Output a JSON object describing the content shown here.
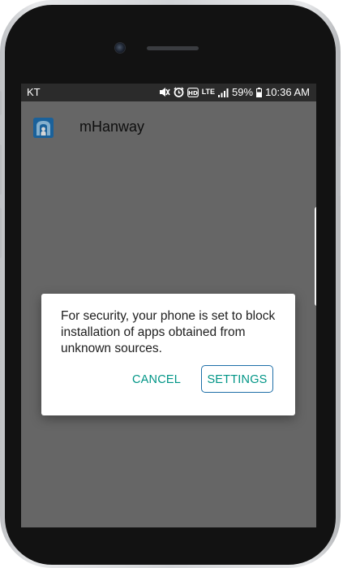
{
  "status_bar": {
    "carrier": "KT",
    "lte": "LTE",
    "battery": "59%",
    "time": "10:36 AM",
    "icons": [
      "mute-icon",
      "alarm-icon",
      "hd-icon",
      "lte-icon",
      "signal-icon",
      "battery-icon"
    ]
  },
  "app": {
    "title": "mHanway",
    "icon": "mhanway-app-icon",
    "accent": "#1f74b8"
  },
  "dialog": {
    "message": "For security, your phone is set to block installation of apps obtained from unknown sources.",
    "cancel_label": "CANCEL",
    "settings_label": "SETTINGS",
    "button_color": "#009586"
  }
}
